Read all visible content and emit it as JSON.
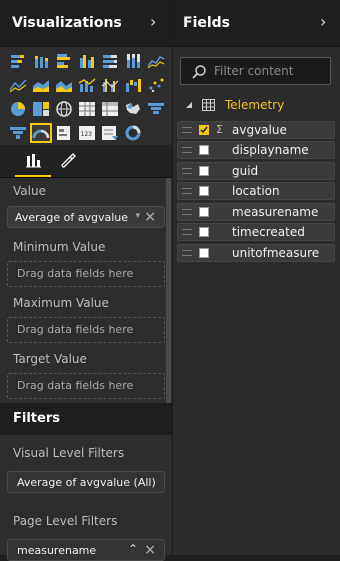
{
  "visualizations": {
    "title": "Visualizations",
    "icons": [
      "stacked-bar-icon",
      "stacked-column-icon",
      "clustered-bar-icon",
      "clustered-column-icon",
      "100-stacked-bar-icon",
      "100-stacked-column-icon",
      "line-chart-icon",
      "area-chart-icon",
      "stacked-area-icon",
      "line-column-icon",
      "line-clustered-column-icon",
      "ribbon-chart-icon",
      "waterfall-icon",
      "scatter-icon",
      "pie-chart-icon",
      "treemap-icon",
      "map-icon",
      "table-icon",
      "matrix-icon",
      "filled-map-icon",
      "funnel-icon",
      "gauge-icon",
      "card-icon",
      "multi-row-card-icon",
      "slicer-icon",
      "donut-icon"
    ],
    "tabs": [
      "fields-tab-icon",
      "format-tab-icon"
    ],
    "value_label": "Value",
    "value_field": "Average of avgvalue",
    "min_label": "Minimum Value",
    "max_label": "Maximum Value",
    "target_label": "Target Value",
    "drag_placeholder": "Drag data fields here"
  },
  "filters": {
    "title": "Filters",
    "visual_label": "Visual Level Filters",
    "visual_filter": "Average of avgvalue (All)",
    "page_label": "Page Level Filters",
    "page_filter": "measurename"
  },
  "fields": {
    "title": "Fields",
    "search_placeholder": "Filter content",
    "table": "Telemetry",
    "items": [
      {
        "name": "avgvalue",
        "checked": true,
        "sigma": "Σ"
      },
      {
        "name": "displayname",
        "checked": false
      },
      {
        "name": "guid",
        "checked": false
      },
      {
        "name": "location",
        "checked": false
      },
      {
        "name": "measurename",
        "checked": false
      },
      {
        "name": "timecreated",
        "checked": false
      },
      {
        "name": "unitofmeasure",
        "checked": false
      }
    ]
  },
  "colors": {
    "accent": "#f2c811",
    "panel": "#2d2d2d",
    "header": "#1e1e1e"
  }
}
